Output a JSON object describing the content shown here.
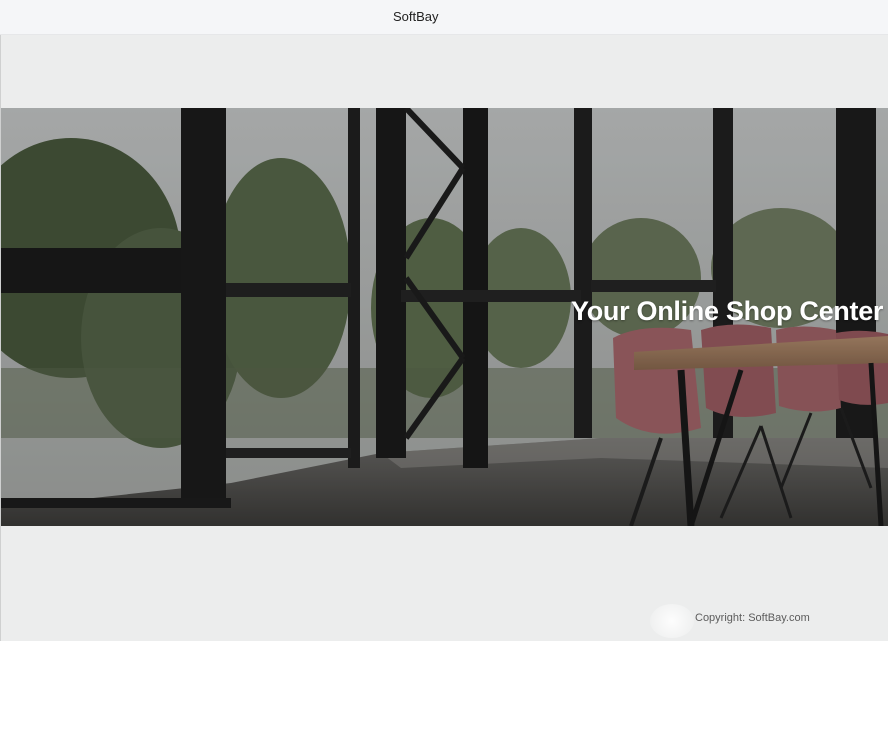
{
  "navbar": {
    "brand": "SoftBay"
  },
  "hero": {
    "title": "Your Online Shop Center",
    "image": "office-interior-with-windows-and-table"
  },
  "footer": {
    "copyright": "Copyright: SoftBay.com"
  }
}
